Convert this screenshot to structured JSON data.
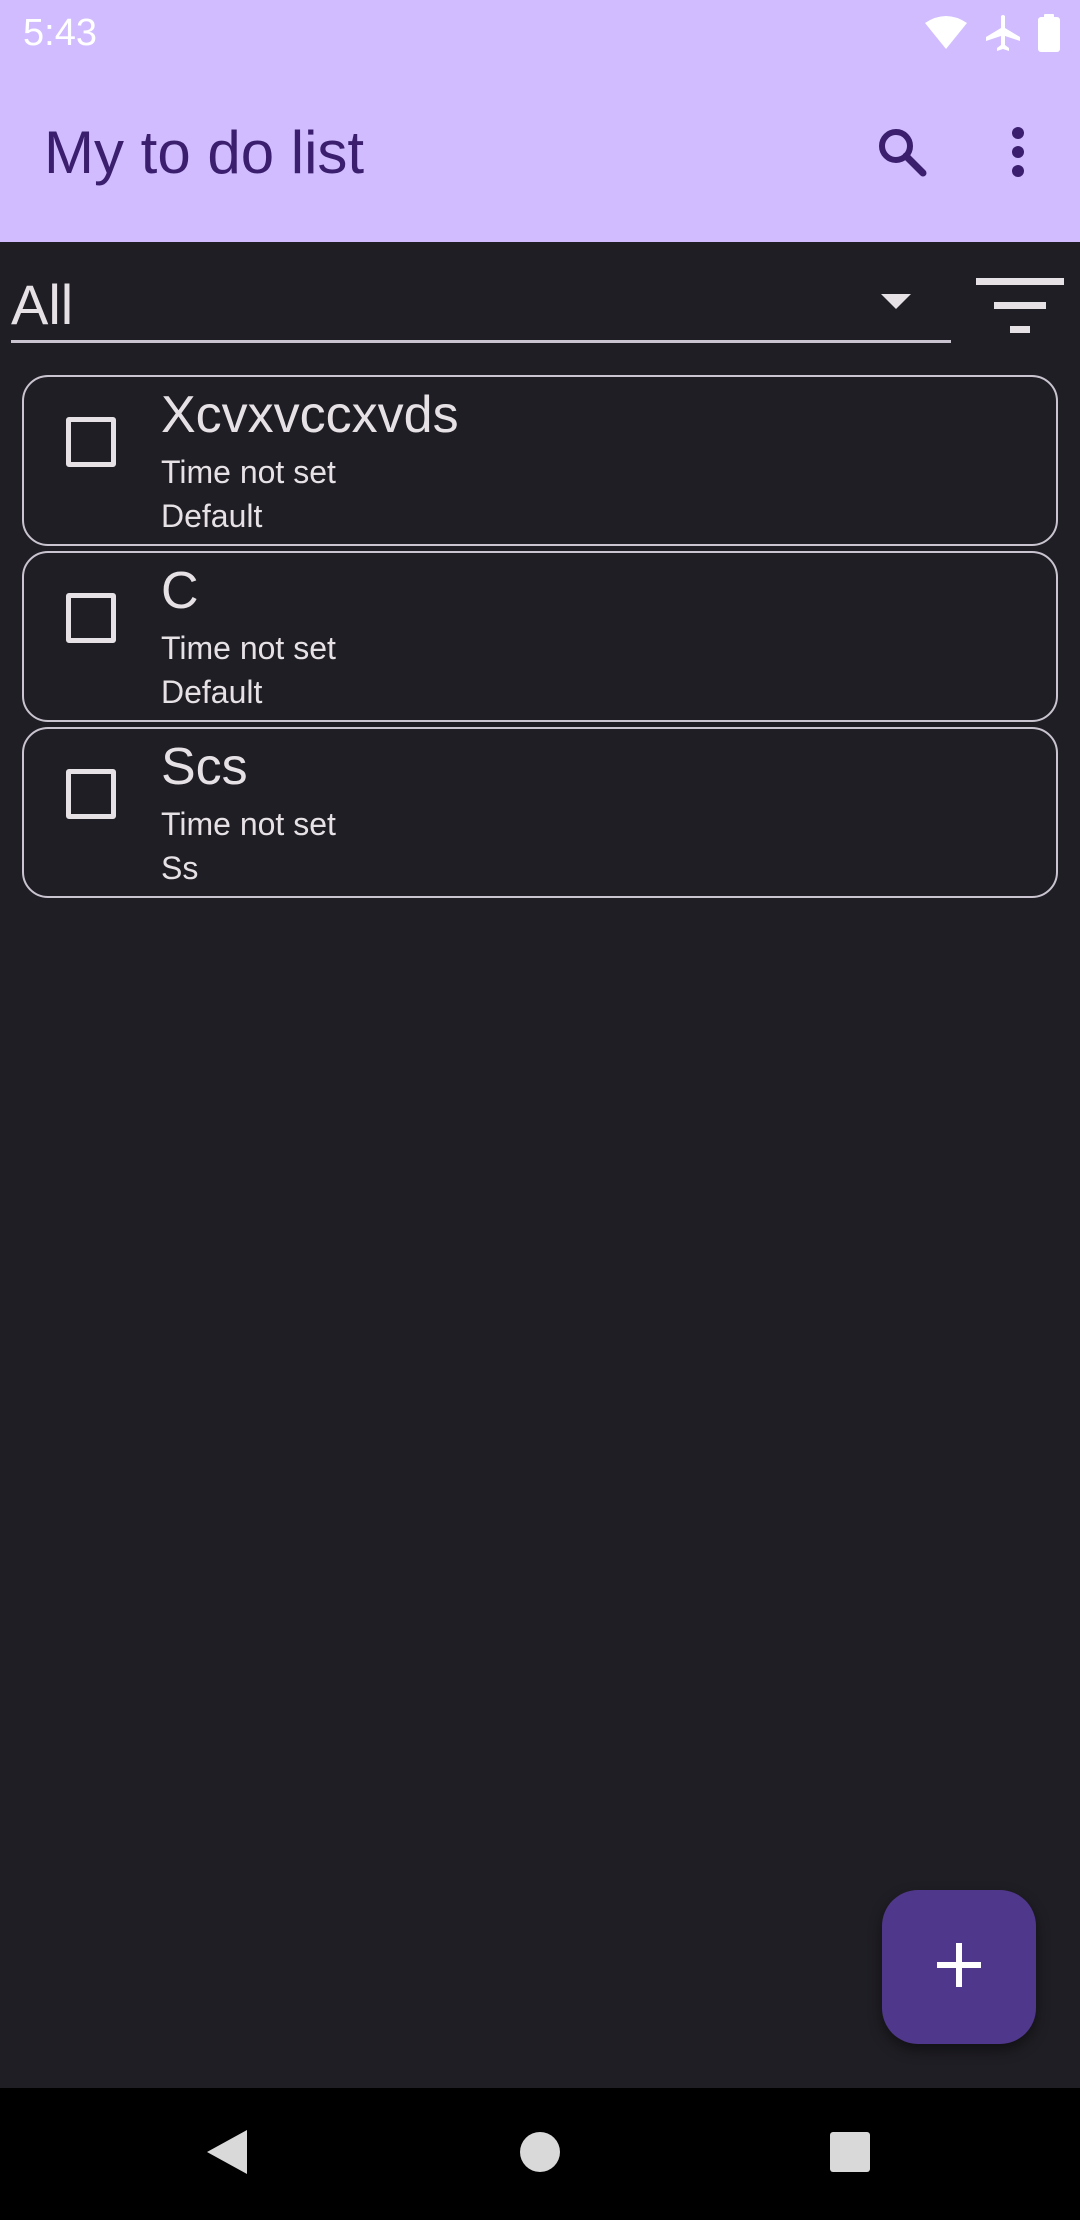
{
  "status_bar": {
    "time": "5:43",
    "icons": [
      "wifi-icon",
      "airplane-mode-icon",
      "battery-icon"
    ]
  },
  "app_bar": {
    "title": "My to do list",
    "actions": [
      "search-icon",
      "more-vert-icon"
    ]
  },
  "filter": {
    "selected": "All",
    "sort_icon": "sort-icon"
  },
  "tasks": [
    {
      "title": "Xcvxvccxvds",
      "time": "Time not set",
      "category": "Default",
      "checked": false
    },
    {
      "title": "C",
      "time": "Time not set",
      "category": "Default",
      "checked": false
    },
    {
      "title": "Scs",
      "time": "Time not set",
      "category": "Ss",
      "checked": false
    }
  ],
  "fab": {
    "icon": "add-icon"
  },
  "nav_bar": {
    "icons": [
      "back-icon",
      "home-icon",
      "recents-icon"
    ]
  },
  "colors": {
    "app_bar": "#d0bcff",
    "title_text": "#3b1f6e",
    "background": "#1f1e24",
    "fab": "#4f378b",
    "text": "#e6e1e5",
    "outline": "#cac4d0"
  }
}
